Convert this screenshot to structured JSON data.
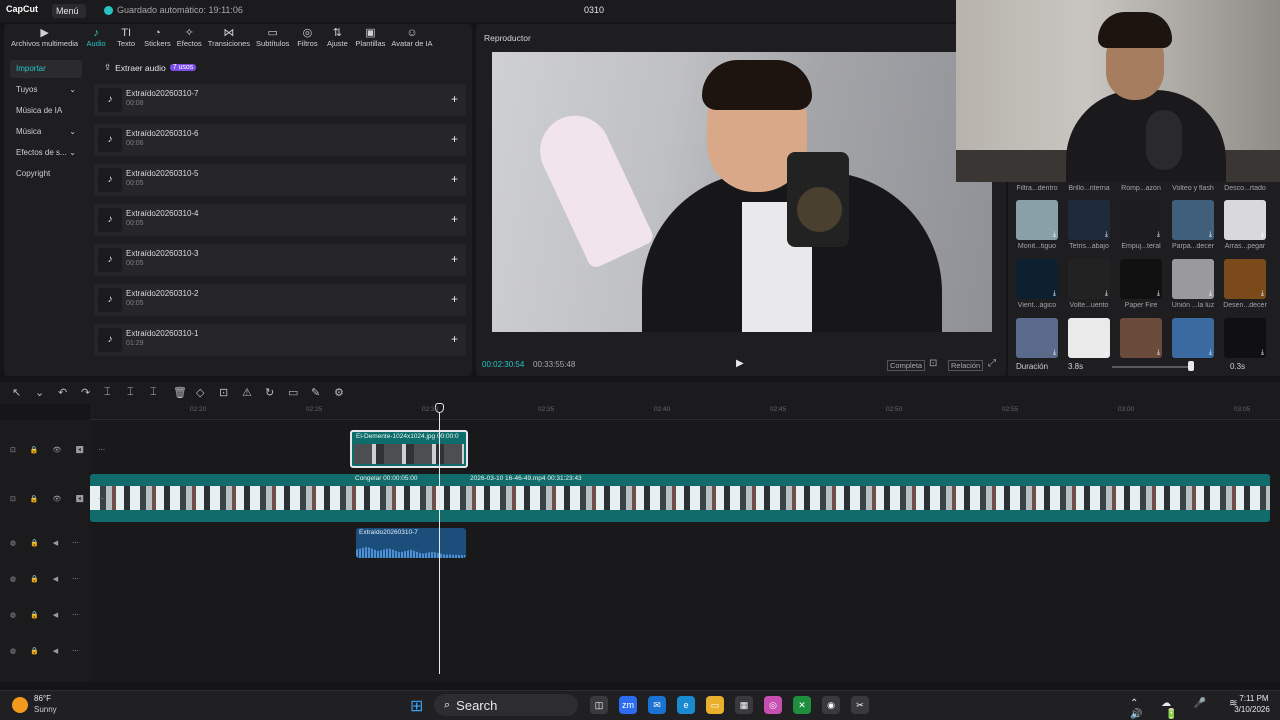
{
  "titlebar": {
    "logo": "CapCut",
    "menu_label": "Menú ⌄",
    "autosave": "Guardado automático: 19:11:06",
    "project_title": "0310"
  },
  "toolbar": {
    "tools": [
      {
        "label": "Archivos multimedia",
        "icon": "▶",
        "icon_name": "media-icon"
      },
      {
        "label": "Audio",
        "icon": "♪",
        "icon_name": "audio-icon",
        "active": true
      },
      {
        "label": "Texto",
        "icon": "TI",
        "icon_name": "text-icon"
      },
      {
        "label": "Stickers",
        "icon": "◔",
        "icon_name": "sticker-icon"
      },
      {
        "label": "Efectos",
        "icon": "✧",
        "icon_name": "effects-icon"
      },
      {
        "label": "Transiciones",
        "icon": "⋈",
        "icon_name": "transitions-icon"
      },
      {
        "label": "Subtítulos",
        "icon": "▭",
        "icon_name": "captions-icon"
      },
      {
        "label": "Filtros",
        "icon": "◎",
        "icon_name": "filters-icon"
      },
      {
        "label": "Ajuste",
        "icon": "⇅",
        "icon_name": "adjust-icon"
      },
      {
        "label": "Plantillas",
        "icon": "▣",
        "icon_name": "templates-icon"
      },
      {
        "label": "Avatar de IA",
        "icon": "☺",
        "icon_name": "ai-avatar-icon"
      }
    ]
  },
  "sidebar": {
    "items": [
      {
        "label": "Importar",
        "active": true,
        "caret": ""
      },
      {
        "label": "Tuyos",
        "caret": "⌄"
      },
      {
        "label": "Música de IA",
        "caret": ""
      },
      {
        "label": "Música",
        "caret": "⌄"
      },
      {
        "label": "Efectos de s...",
        "caret": "⌄"
      },
      {
        "label": "Copyright",
        "caret": ""
      }
    ]
  },
  "extract": {
    "label": "Extraer audio",
    "badge": "7 usos",
    "icon": "⇪"
  },
  "audio_items": [
    {
      "name": "Extraído20260310-7",
      "duration": "00:08"
    },
    {
      "name": "Extraído20260310-6",
      "duration": "00:06"
    },
    {
      "name": "Extraído20260310-5",
      "duration": "00:05"
    },
    {
      "name": "Extraído20260310-4",
      "duration": "00:05"
    },
    {
      "name": "Extraído20260310-3",
      "duration": "00:05"
    },
    {
      "name": "Extraído20260310-2",
      "duration": "00:05"
    },
    {
      "name": "Extraído20260310-1",
      "duration": "01:29"
    }
  ],
  "player": {
    "title": "Reproductor",
    "time_current": "00:02:30:54",
    "time_total": "00:33:55:48",
    "play_icon": "▶",
    "completa": "Completa",
    "relacion": "Relación",
    "zoom_icon": "⊡",
    "fullscreen_icon": "⤢"
  },
  "transitions": {
    "top_labels": [
      "Filtra...dentro",
      "Brillo...nterna",
      "Romp...azón",
      "Volteo y flash",
      "Desco...rtado"
    ],
    "rows": [
      {
        "labels": [
          "Monit...tiguo",
          "Tetris...abajo",
          "Empuj...teral",
          "Parpa...decer",
          "Arras...pegar"
        ],
        "colors": [
          "#8aa0a8",
          "#1f2a3a",
          "#1d1d1f",
          "#3f5f7a",
          "#d9d9dd"
        ]
      },
      {
        "labels": [
          "Vient...ágico",
          "Volte...uento",
          "Paper Fire",
          "Unión ...la luz",
          "Desen...decer"
        ],
        "colors": [
          "#0d2030",
          "#222",
          "#111",
          "#9a9a9e",
          "#7a4a1a"
        ]
      },
      {
        "labels": [
          "",
          "",
          "",
          "",
          ""
        ],
        "colors": [
          "#5a6a8a",
          "#eaeaea",
          "#6a4a3a",
          "#3a6aa0",
          "#101012"
        ]
      }
    ],
    "duration_label": "Duración",
    "duration_value": "3.8s",
    "duration_right": "0.3s",
    "download_icon": "⤓"
  },
  "timeline": {
    "ticks": [
      "02:20",
      "02:25",
      "02:30",
      "02:35",
      "02:40",
      "02:45",
      "02:50",
      "02:55",
      "03:00",
      "03:05"
    ],
    "image_clip": "El-Demente-1024x1024.jpg  00:00:0",
    "freeze_label": "Congelar  00:00:05:00",
    "main_clip": "2026-03-10 16-46-49.mp4  00:31:23:43",
    "audio_clip": "Extraído20260310-7",
    "track_controls": "⊡ 🔒 👁 ◀ ⋯",
    "audio_controls": "◍ 🔒 ◀ ⋯",
    "toolbar_icons": [
      "↖",
      "⌄",
      "↶",
      "↷",
      "⌶",
      "⌶",
      "⌶",
      "🗑",
      "◇",
      "⊡",
      "⚠",
      "↻",
      "▭",
      "✎",
      "⚙"
    ]
  },
  "taskbar": {
    "weather_temp": "86°F",
    "weather_desc": "Sunny",
    "search_label": "Search",
    "search_icon": "⌕",
    "start_icon": "⊞",
    "time": "7:11 PM",
    "date": "3/10/2026",
    "tray_icons": "⌃ ☁ 🎤 ≋ 🔊 🔋",
    "apps": [
      {
        "label": "◫",
        "color": "#3a3a3e"
      },
      {
        "label": "zm",
        "color": "#2d6cf1"
      },
      {
        "label": "✉",
        "color": "#1b73d1"
      },
      {
        "label": "e",
        "color": "#1b8bd1"
      },
      {
        "label": "▭",
        "color": "#e8b02c"
      },
      {
        "label": "▦",
        "color": "#3a3a3e"
      },
      {
        "label": "◎",
        "color": "#c74fb1"
      },
      {
        "label": "✕",
        "color": "#1f8f3f"
      },
      {
        "label": "◉",
        "color": "#3a3a3e"
      },
      {
        "label": "✂",
        "color": "#3a3a3e"
      }
    ]
  }
}
